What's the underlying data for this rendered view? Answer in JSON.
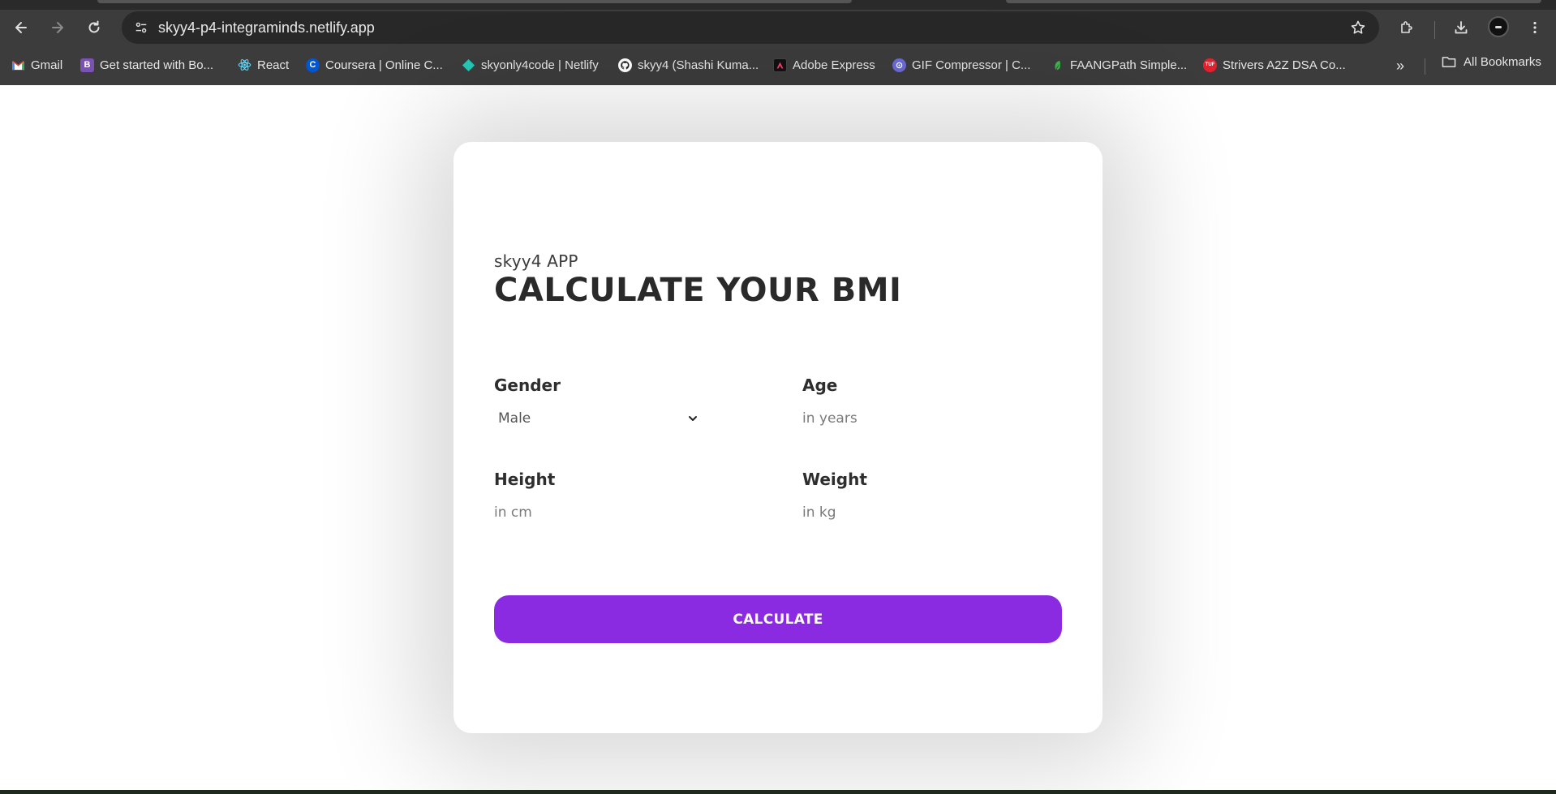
{
  "browser": {
    "url": "skyy4-p4-integraminds.netlify.app",
    "bookmarks": [
      {
        "label": "Gmail",
        "icon": "gmail-icon",
        "color": "#ea4335"
      },
      {
        "label": "Get started with Bo...",
        "icon": "bootstrap-icon",
        "color": "#7952b3"
      },
      {
        "label": "React",
        "icon": "react-icon",
        "color": "#61dafb"
      },
      {
        "label": "Coursera | Online C...",
        "icon": "coursera-icon",
        "color": "#0056d2"
      },
      {
        "label": "skyonly4code | Netlify",
        "icon": "netlify-icon",
        "color": "#25c7b7"
      },
      {
        "label": "skyy4 (Shashi Kuma...",
        "icon": "github-icon",
        "color": "#ffffff"
      },
      {
        "label": "Adobe Express",
        "icon": "adobe-express-icon",
        "color": "#1a1a1a"
      },
      {
        "label": "GIF Compressor | C...",
        "icon": "gif-compressor-icon",
        "color": "#6b6bd6"
      },
      {
        "label": "FAANGPath Simple...",
        "icon": "faangpath-icon",
        "color": "#3bb54a"
      },
      {
        "label": "Strivers A2Z DSA Co...",
        "icon": "tuf-icon",
        "icon_text": "TUF",
        "color": "#e5202e"
      }
    ],
    "all_bookmarks_label": "All Bookmarks",
    "overflow_glyph": "»"
  },
  "app": {
    "app_name": "skyy4 APP",
    "title": "CALCULATE YOUR BMI",
    "gender": {
      "label": "Gender",
      "value": "Male"
    },
    "age": {
      "label": "Age",
      "placeholder": "in years"
    },
    "height": {
      "label": "Height",
      "placeholder": "in cm"
    },
    "weight": {
      "label": "Weight",
      "placeholder": "in kg"
    },
    "button_label": "CALCULATE",
    "accent_color": "#8a2be2"
  }
}
